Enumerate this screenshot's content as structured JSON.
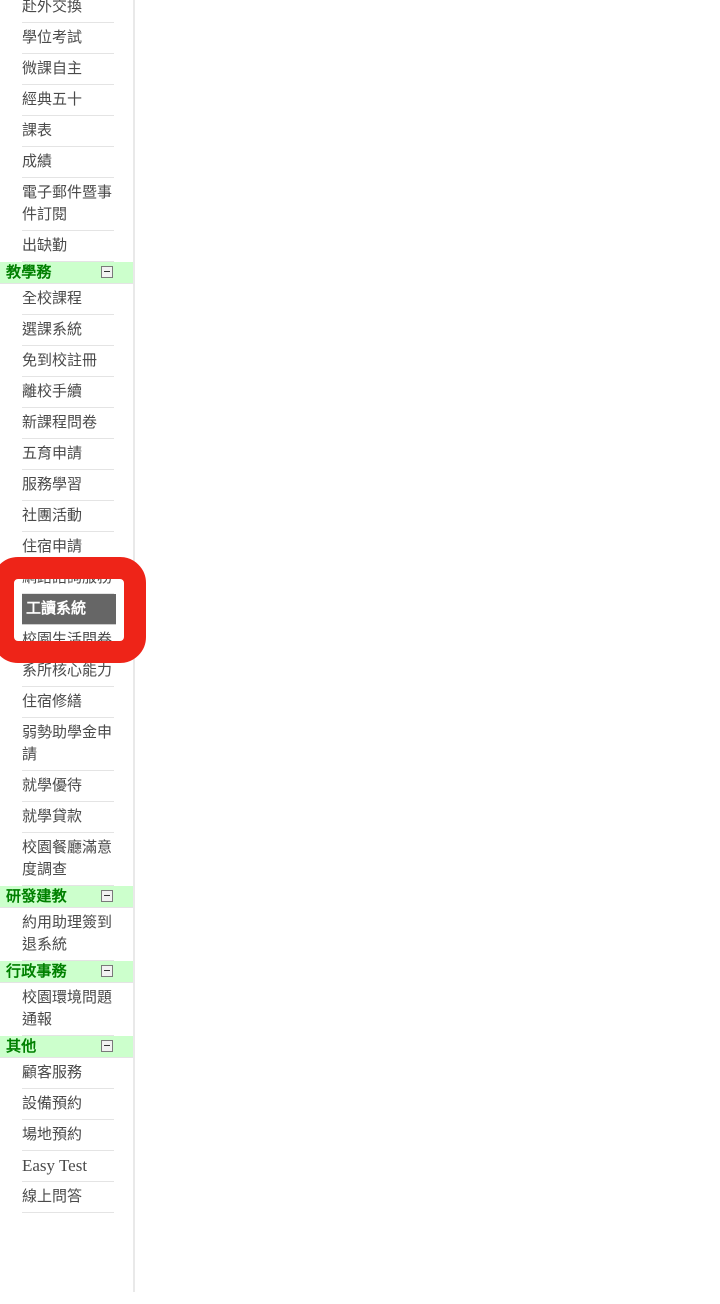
{
  "sidebar": {
    "groups": [
      {
        "type": "items",
        "items": [
          {
            "label": "赴外交換",
            "script": "cjk"
          },
          {
            "label": "學位考試",
            "script": "cjk"
          },
          {
            "label": "微課自主",
            "script": "cjk"
          },
          {
            "label": "經典五十",
            "script": "cjk"
          },
          {
            "label": "課表",
            "script": "cjk"
          },
          {
            "label": "成績",
            "script": "cjk"
          },
          {
            "label": "電子郵件暨事件訂閱",
            "script": "cjk"
          },
          {
            "label": "出缺勤",
            "script": "cjk"
          }
        ]
      },
      {
        "type": "section",
        "header": {
          "label": "教學務",
          "toggle": "collapse-minus-icon"
        },
        "items": [
          {
            "label": "全校課程",
            "script": "cjk"
          },
          {
            "label": "選課系統",
            "script": "cjk"
          },
          {
            "label": "免到校註冊",
            "script": "cjk"
          },
          {
            "label": "離校手續",
            "script": "cjk"
          },
          {
            "label": "新課程問卷",
            "script": "cjk"
          },
          {
            "label": "五育申請",
            "script": "cjk"
          },
          {
            "label": "服務學習",
            "script": "cjk"
          },
          {
            "label": "社團活動",
            "script": "cjk"
          },
          {
            "label": "住宿申請",
            "script": "cjk"
          },
          {
            "label": "網路諮詢服務",
            "script": "cjk",
            "obscured": true
          },
          {
            "label": "工讀系統",
            "script": "cjk",
            "selected": true
          },
          {
            "label": "校園生活問卷",
            "script": "cjk"
          },
          {
            "label": "系所核心能力",
            "script": "cjk"
          },
          {
            "label": "住宿修繕",
            "script": "cjk"
          },
          {
            "label": "弱勢助學金申請",
            "script": "cjk"
          },
          {
            "label": "就學優待",
            "script": "cjk"
          },
          {
            "label": "就學貸款",
            "script": "cjk"
          },
          {
            "label": "校園餐廳滿意度調查",
            "script": "cjk"
          }
        ]
      },
      {
        "type": "section",
        "header": {
          "label": "研發建教",
          "toggle": "collapse-minus-icon"
        },
        "items": [
          {
            "label": "約用助理簽到退系統",
            "script": "cjk"
          }
        ]
      },
      {
        "type": "section",
        "header": {
          "label": "行政事務",
          "toggle": "collapse-minus-icon"
        },
        "items": [
          {
            "label": "校園環境問題通報",
            "script": "cjk"
          }
        ]
      },
      {
        "type": "section",
        "header": {
          "label": "其他",
          "toggle": "collapse-minus-icon"
        },
        "items": [
          {
            "label": "顧客服務",
            "script": "cjk"
          },
          {
            "label": "設備預約",
            "script": "cjk"
          },
          {
            "label": "場地預約",
            "script": "cjk"
          },
          {
            "label": "Easy Test",
            "script": "latin"
          },
          {
            "label": "線上問答",
            "script": "cjk"
          }
        ]
      }
    ]
  },
  "annotation": {
    "shape": "rounded-rectangle-highlight",
    "color": "#ee2418",
    "target_label": "工讀系統"
  },
  "colors": {
    "section_header_bg": "#ccffcc",
    "section_header_text": "#008000",
    "selected_bg": "#666666",
    "selected_text": "#ffffff",
    "item_text": "#4a4a4a",
    "divider": "#e4e4e4",
    "annotation": "#ee2418"
  }
}
